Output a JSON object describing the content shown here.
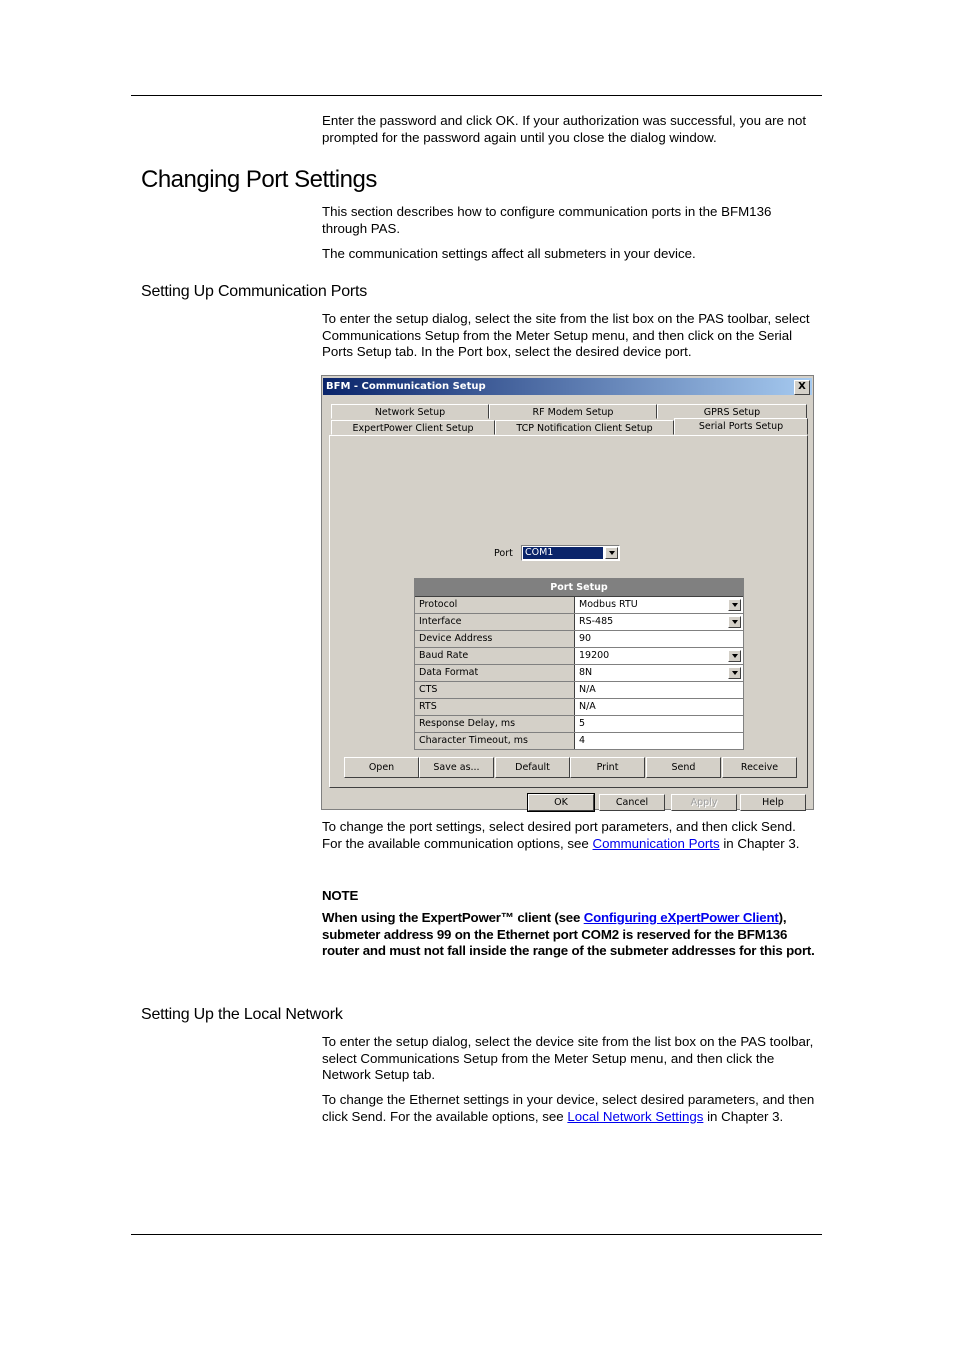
{
  "intro": {
    "text": "Enter the password and click OK. If your authorization was successful, you are not prompted for the password again until you close the dialog window."
  },
  "section": {
    "title": "Changing Port Settings",
    "p1": "This section describes how to configure communication ports in the BFM136 through PAS.",
    "p2": "The communication settings affect all submeters in your device."
  },
  "comm_ports": {
    "title": "Setting Up Communication Ports",
    "p1": "To enter the setup dialog, select the site from the list box on the PAS toolbar, select Communications Setup from the Meter Setup menu, and then click on the Serial Ports Setup tab. In the Port box, select the desired device port.",
    "after_before_link": "To change the port settings, select desired port parameters, and then click Send. For the available communication options, see ",
    "after_link": "Communication Ports",
    "after_after_link": " in Chapter 3.",
    "note_title": "NOTE",
    "note_before_link": "When using the ExpertPower™ client (see ",
    "note_link": "Configuring eXpertPower Client",
    "note_after_link": "), submeter address 99 on the Ethernet port COM2 is reserved for the BFM136 router and must not fall inside the range of the submeter addresses for this port."
  },
  "local_network": {
    "title": "Setting Up the Local Network",
    "p1": "To enter the setup dialog, select the device site from the list box on the PAS toolbar, select Communications Setup from the Meter Setup menu, and then click the Network Setup tab.",
    "p2_before_link": "To change the Ethernet settings in your device, select desired parameters, and then click Send. For the available options, see ",
    "p2_link": "Local Network Settings",
    "p2_after_link": " in Chapter 3."
  },
  "dialog": {
    "title": "BFM - Communication Setup",
    "close_label": "X",
    "tabs_row1": [
      "Network Setup",
      "RF Modem Setup",
      "GPRS Setup"
    ],
    "tabs_row2": [
      "ExpertPower Client Setup",
      "TCP Notification Client Setup",
      "Serial Ports Setup"
    ],
    "active_tab": "Serial Ports Setup",
    "port_label": "Port",
    "port_value": "COM1",
    "grid_title": "Port Setup",
    "rows": [
      {
        "label": "Protocol",
        "value": "Modbus RTU",
        "dropdown": true
      },
      {
        "label": "Interface",
        "value": "RS-485",
        "dropdown": true
      },
      {
        "label": "Device Address",
        "value": "90",
        "dropdown": false
      },
      {
        "label": "Baud Rate",
        "value": "19200",
        "dropdown": true
      },
      {
        "label": "Data Format",
        "value": "8N",
        "dropdown": true
      },
      {
        "label": "CTS",
        "value": "N/A",
        "dropdown": false
      },
      {
        "label": "RTS",
        "value": "N/A",
        "dropdown": false
      },
      {
        "label": "Response Delay, ms",
        "value": "5",
        "dropdown": false
      },
      {
        "label": "Character Timeout, ms",
        "value": "4",
        "dropdown": false
      }
    ],
    "panel_buttons": [
      "Open",
      "Save as...",
      "Default",
      "Print",
      "Send",
      "Receive"
    ],
    "footer_buttons": [
      "OK",
      "Cancel",
      "Apply",
      "Help"
    ]
  }
}
